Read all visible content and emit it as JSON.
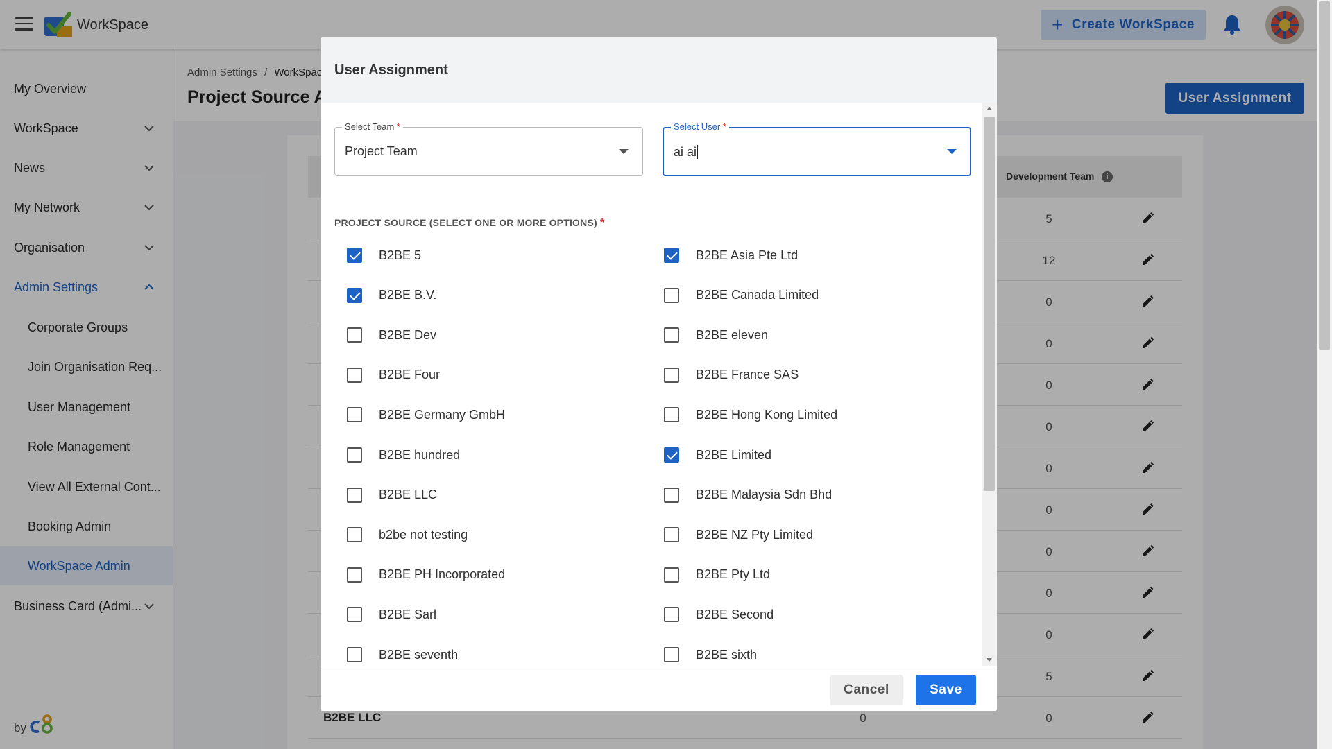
{
  "app": {
    "brand": "WorkSpace"
  },
  "topbar": {
    "create_label": "Create WorkSpace"
  },
  "sidebar": {
    "items": [
      {
        "label": "My Overview"
      },
      {
        "label": "WorkSpace"
      },
      {
        "label": "News"
      },
      {
        "label": "My Network"
      },
      {
        "label": "Organisation"
      },
      {
        "label": "Admin Settings"
      },
      {
        "label": "Corporate Groups"
      },
      {
        "label": "Join Organisation Req..."
      },
      {
        "label": "User Management"
      },
      {
        "label": "Role Management"
      },
      {
        "label": "View All External Cont..."
      },
      {
        "label": "Booking Admin"
      },
      {
        "label": "WorkSpace Admin"
      },
      {
        "label": "Business Card (Admi..."
      }
    ],
    "byline": "by"
  },
  "page": {
    "breadcrumb": [
      "Admin Settings",
      "/",
      "WorkSpace Admin"
    ],
    "title": "Project Source Assignment",
    "assign_button": "User Assignment",
    "column_header": "Development Team",
    "rows": [
      {
        "name": "",
        "c1": "",
        "c2": "5"
      },
      {
        "name": "",
        "c1": "",
        "c2": "12"
      },
      {
        "name": "",
        "c1": "",
        "c2": "0"
      },
      {
        "name": "",
        "c1": "",
        "c2": "0"
      },
      {
        "name": "",
        "c1": "",
        "c2": "0"
      },
      {
        "name": "",
        "c1": "",
        "c2": "0"
      },
      {
        "name": "",
        "c1": "",
        "c2": "0"
      },
      {
        "name": "",
        "c1": "",
        "c2": "0"
      },
      {
        "name": "",
        "c1": "",
        "c2": "0"
      },
      {
        "name": "",
        "c1": "",
        "c2": "0"
      },
      {
        "name": "",
        "c1": "",
        "c2": "0"
      },
      {
        "name": "",
        "c1": "",
        "c2": "5"
      },
      {
        "name": "B2BE LLC",
        "c1": "0",
        "c2": "0"
      }
    ]
  },
  "modal": {
    "title": "User Assignment",
    "team": {
      "label": "Select Team",
      "required": "*",
      "value": "Project Team"
    },
    "user": {
      "label": "Select User",
      "required": "*",
      "value": "ai ai"
    },
    "section_label": "PROJECT SOURCE (SELECT ONE OR MORE OPTIONS)",
    "section_required": "*",
    "options": [
      {
        "label": "B2BE 5",
        "checked": true
      },
      {
        "label": "B2BE Asia Pte Ltd",
        "checked": true
      },
      {
        "label": "B2BE B.V.",
        "checked": true
      },
      {
        "label": "B2BE Canada Limited",
        "checked": false
      },
      {
        "label": "B2BE Dev",
        "checked": false
      },
      {
        "label": "B2BE eleven",
        "checked": false
      },
      {
        "label": "B2BE Four",
        "checked": false
      },
      {
        "label": "B2BE France SAS",
        "checked": false
      },
      {
        "label": "B2BE Germany GmbH",
        "checked": false
      },
      {
        "label": "B2BE Hong Kong Limited",
        "checked": false
      },
      {
        "label": "B2BE hundred",
        "checked": false
      },
      {
        "label": "B2BE Limited",
        "checked": true
      },
      {
        "label": "B2BE LLC",
        "checked": false
      },
      {
        "label": "B2BE Malaysia Sdn Bhd",
        "checked": false
      },
      {
        "label": "b2be not testing",
        "checked": false
      },
      {
        "label": "B2BE NZ Pty Limited",
        "checked": false
      },
      {
        "label": "B2BE PH Incorporated",
        "checked": false
      },
      {
        "label": "B2BE Pty Ltd",
        "checked": false
      },
      {
        "label": "B2BE Sarl",
        "checked": false
      },
      {
        "label": "B2BE Second",
        "checked": false
      },
      {
        "label": "B2BE seventh",
        "checked": false
      },
      {
        "label": "B2BE sixth",
        "checked": false
      }
    ],
    "cancel_label": "Cancel",
    "save_label": "Save"
  },
  "colors": {
    "accent": "#1e63c4",
    "save_button": "#1e73e8",
    "required": "#d32f2f",
    "selected_nav_bg": "#e6eefb"
  },
  "icons": [
    "hamburger-icon",
    "workspace-logo-icon",
    "plus-icon",
    "bell-icon",
    "avatar",
    "chevron-down-icon",
    "chevron-up-icon",
    "info-icon",
    "edit-pencil-icon",
    "dropdown-caret-icon",
    "c8-logo-icon"
  ]
}
